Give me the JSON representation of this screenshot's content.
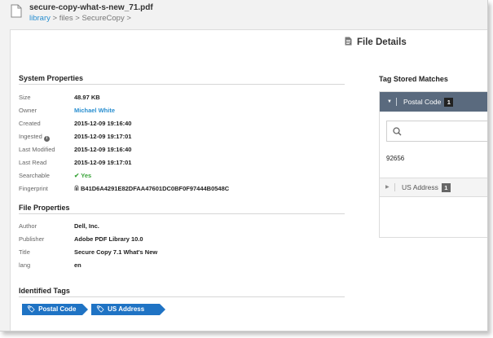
{
  "header": {
    "file_name": "secure-copy-what-s-new_71.pdf",
    "breadcrumb": {
      "root": "library",
      "sep1": " > ",
      "mid": "files",
      "sep2": " > ",
      "leaf": "SecureCopy >"
    }
  },
  "page_title": "File Details",
  "system_properties": {
    "title": "System Properties",
    "rows": [
      {
        "label": "Size",
        "value": "48.97 KB"
      },
      {
        "label": "Owner",
        "value": "Michael White"
      },
      {
        "label": "Created",
        "value": "2015-12-09 19:16:40"
      },
      {
        "label": "Ingested",
        "value": "2015-12-09 19:17:01"
      },
      {
        "label": "Last Modified",
        "value": "2015-12-09 19:16:40"
      },
      {
        "label": "Last Read",
        "value": "2015-12-09 19:17:01"
      },
      {
        "label": "Searchable",
        "value": "Yes"
      },
      {
        "label": "Fingerprint",
        "value": "B41D6A4291E82DFAA47601DC0BF0F97444B0548C"
      }
    ]
  },
  "file_properties": {
    "title": "File Properties",
    "rows": [
      {
        "label": "Author",
        "value": "Dell, Inc."
      },
      {
        "label": "Publisher",
        "value": "Adobe PDF Library 10.0"
      },
      {
        "label": "Title",
        "value": "Secure Copy 7.1 What's New"
      },
      {
        "label": "lang",
        "value": "en"
      }
    ]
  },
  "identified_tags": {
    "title": "Identified Tags",
    "tags": [
      "Postal Code",
      "US Address"
    ]
  },
  "tag_stored_matches": {
    "title": "Tag Stored Matches",
    "groups": [
      {
        "label": "Postal Code",
        "count": "1",
        "expanded": true,
        "matches": [
          "92656"
        ]
      },
      {
        "label": "US Address",
        "count": "1",
        "expanded": false
      }
    ],
    "search": {
      "placeholder": ""
    }
  },
  "colors": {
    "link": "#2a8fd0",
    "tag_bg": "#1f73c4",
    "accordion_active": "#5a6a7e",
    "success": "#3aa43a"
  },
  "icons": {
    "file": "document-icon",
    "details": "file-details-icon",
    "info": "info-icon",
    "check": "check-icon",
    "fingerprint": "fingerprint-icon",
    "tag": "tag-icon",
    "search": "search-icon",
    "caret_down": "caret-down-icon",
    "caret_right": "caret-right-icon"
  }
}
